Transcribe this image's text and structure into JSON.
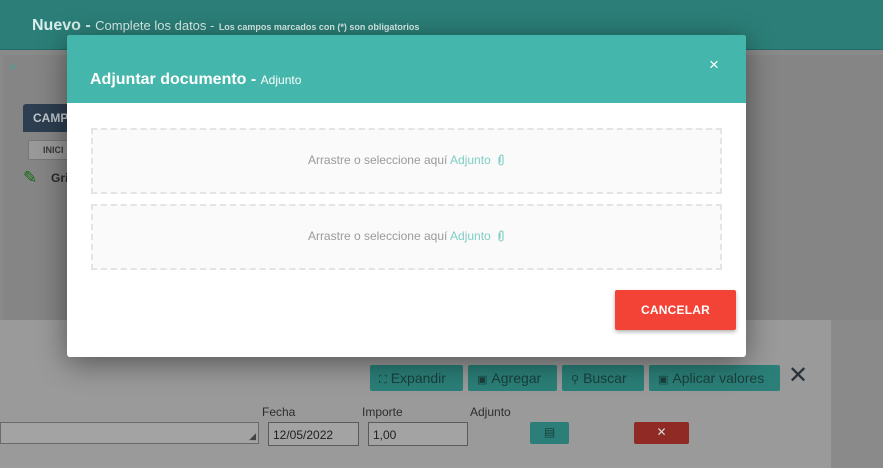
{
  "background": {
    "header": {
      "title": "Nuevo -",
      "subtitle": "Complete los datos -",
      "required_note": "Los campos marcados con (*) son obligatorios"
    },
    "tab_label": "CAMP",
    "subtab_label": "INICI",
    "grid_label": "Gri",
    "toolbar": {
      "expand_label": "Expandir",
      "add_label": "Agregar",
      "search_label": "Buscar",
      "apply_label": "Aplicar valores",
      "close_label": "✕"
    },
    "form": {
      "fecha_label": "Fecha",
      "fecha_value": "12/05/2022",
      "importe_label": "Importe",
      "importe_value": "1,00",
      "adjunto_label": "Adjunto",
      "delete_label": "✕"
    }
  },
  "modal": {
    "title": "Adjuntar documento -",
    "subtitle": "Adjunto",
    "close_label": "×",
    "dropzones": [
      {
        "prefix": "Arrastre o seleccione aquí",
        "link": "Adjunto"
      },
      {
        "prefix": "Arrastre o seleccione aquí",
        "link": "Adjunto"
      }
    ],
    "cancel_label": "CANCELAR"
  },
  "colors": {
    "accent": "#45b6ac",
    "danger": "#f34336",
    "link": "#7fcdc6"
  },
  "icons": [
    "paperclip-icon",
    "close-icon",
    "expand-icon",
    "file-add-icon",
    "search-icon",
    "file-icon",
    "pencil-icon",
    "chevron-right-icon",
    "resize-grip-icon"
  ]
}
